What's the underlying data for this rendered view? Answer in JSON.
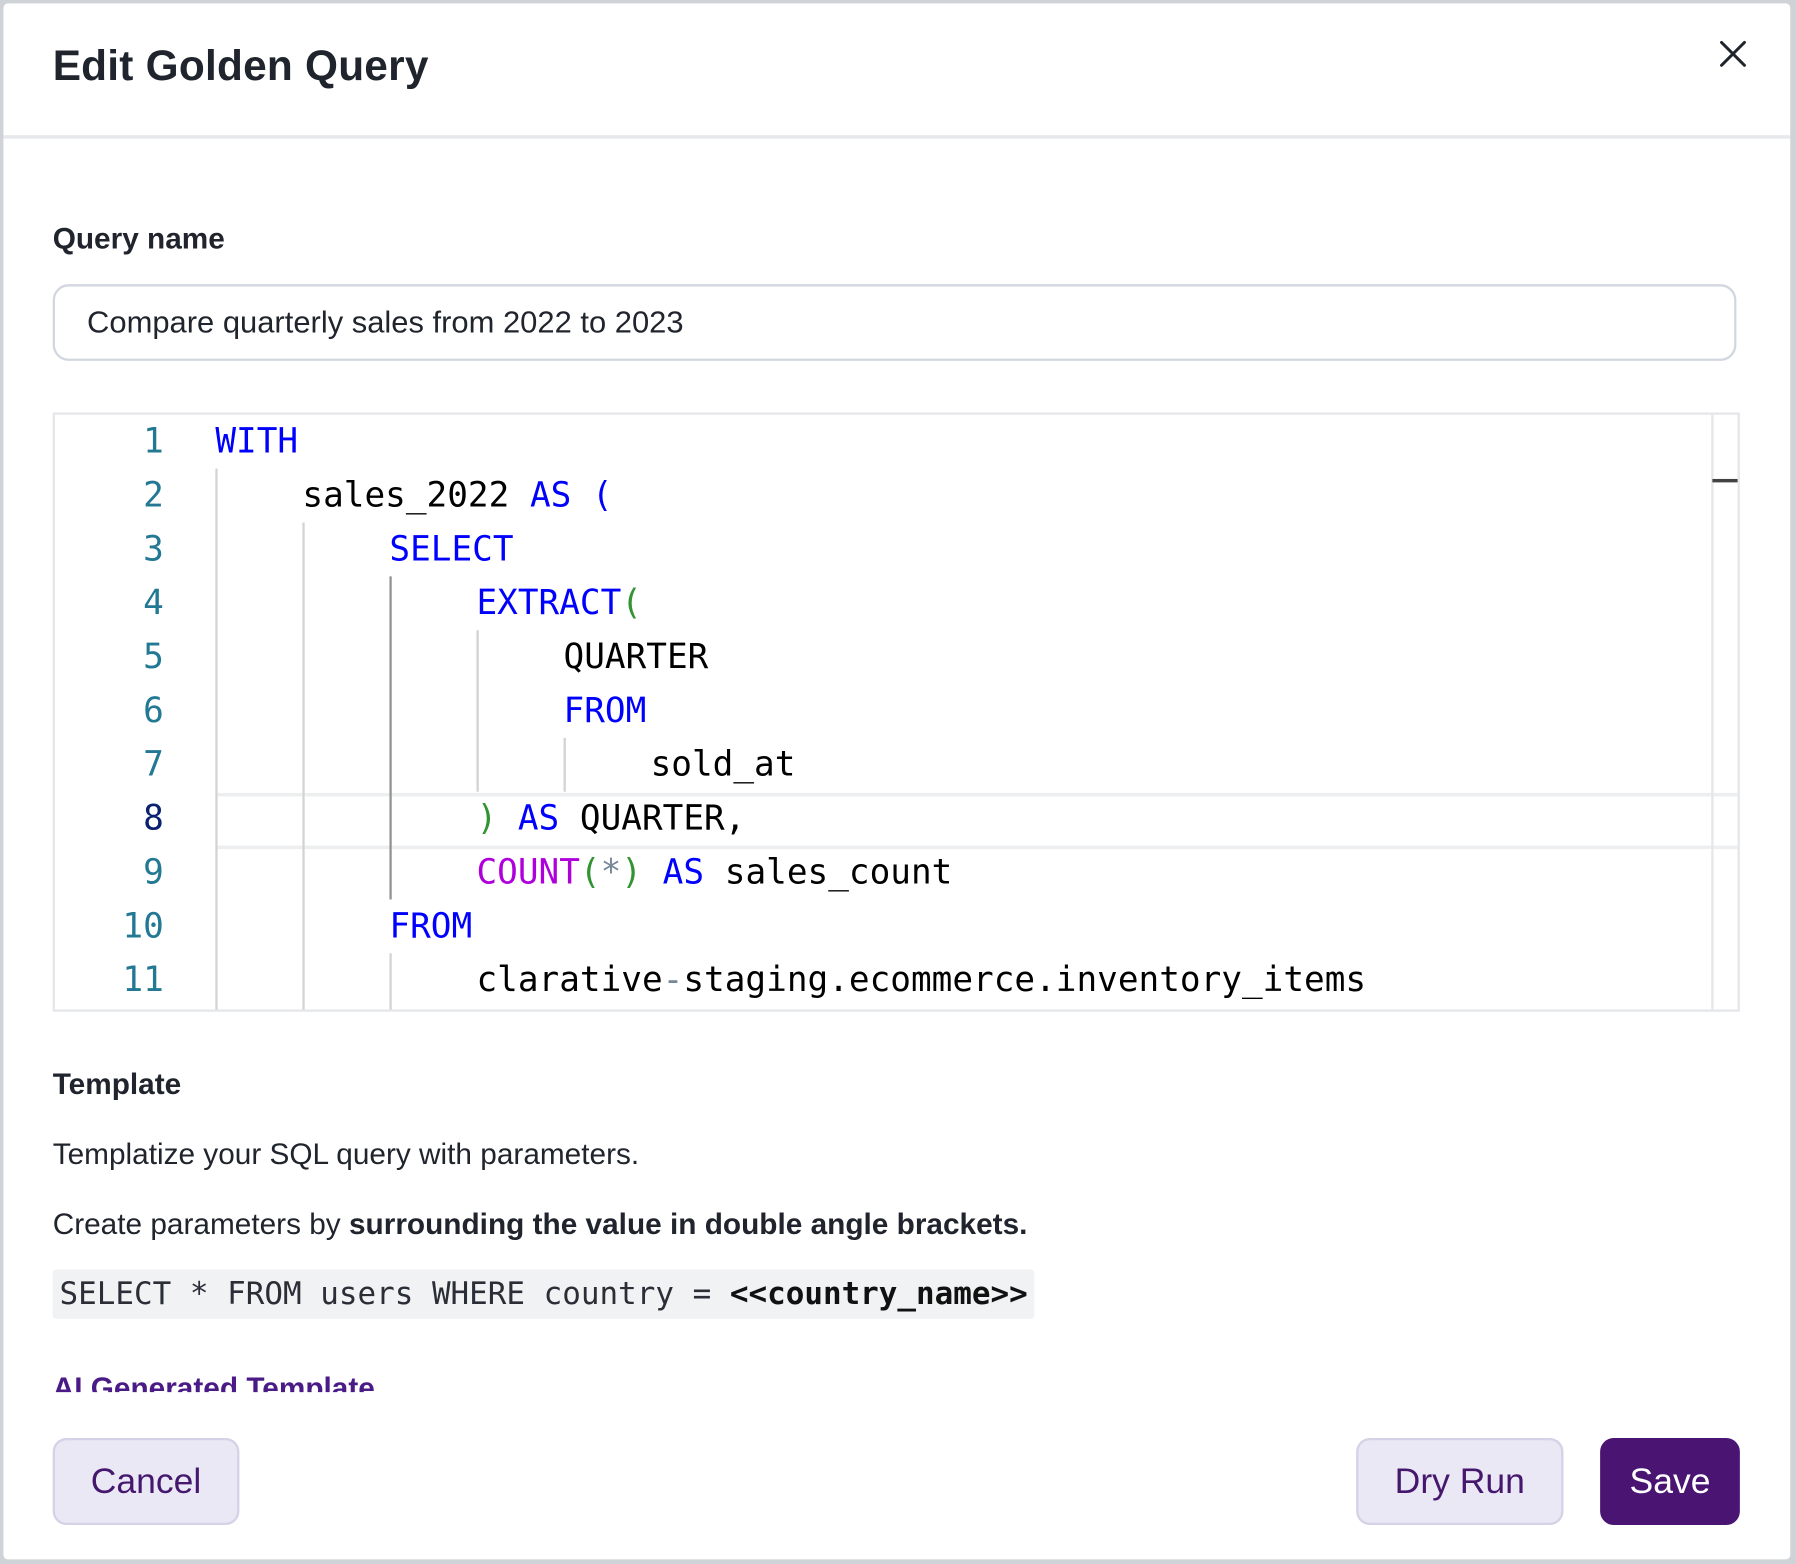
{
  "dialog": {
    "title": "Edit Golden Query",
    "close_icon": "close-icon"
  },
  "query_name": {
    "label": "Query name",
    "value": "Compare quarterly sales from 2022 to 2023"
  },
  "editor": {
    "line_numbers": [
      "1",
      "2",
      "3",
      "4",
      "5",
      "6",
      "7",
      "8",
      "9",
      "10",
      "11"
    ],
    "active_line": "8",
    "lines": [
      [
        "WITH"
      ],
      [
        "sales_2022",
        "AS",
        "("
      ],
      [
        "SELECT"
      ],
      [
        "EXTRACT",
        "("
      ],
      [
        "QUARTER"
      ],
      [
        "FROM"
      ],
      [
        "sold_at"
      ],
      [
        ")",
        "AS",
        "QUARTER,"
      ],
      [
        "COUNT",
        "(",
        "*",
        ")",
        "AS",
        "sales_count"
      ],
      [
        "FROM"
      ],
      [
        "clarative",
        "-",
        "staging.ecommerce.inventory_items"
      ]
    ]
  },
  "template": {
    "heading": "Template",
    "description": "Templatize your SQL query with parameters.",
    "instruction_prefix": "Create parameters by ",
    "instruction_bold": "surrounding the value in double angle brackets.",
    "example_code": "SELECT * FROM users WHERE country = ",
    "example_param": "<<country_name>>",
    "ai_link": "AI Generated Template"
  },
  "actions": {
    "cancel": "Cancel",
    "dry_run": "Dry Run",
    "save": "Save"
  },
  "colors": {
    "primary": "#4a1572",
    "secondary_bg": "#ebe8f6",
    "keyword": "#0000ff",
    "function": "#af00db",
    "line_number": "#237893"
  }
}
